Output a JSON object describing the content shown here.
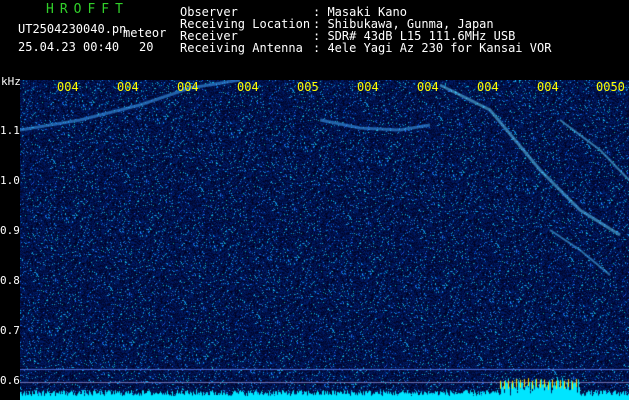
{
  "app": {
    "name": "HROFFT",
    "filename": "UT2504230040.pn",
    "mode": "meteor",
    "date_time": "25.04.23 00:40",
    "interval": "20"
  },
  "info": {
    "labels": [
      "Observer",
      "Receiving Location",
      "Receiver",
      "Receiving Antenna"
    ],
    "values": [
      ": Masaki Kano",
      ": Shibukawa, Gunma, Japan",
      ": SDR# 43dB L15 111.6MHz USB",
      ": 4ele Yagi Az 230 for Kansai VOR"
    ]
  },
  "axis": {
    "unit": "kHz",
    "freq_ticks": [
      "1.1",
      "1.0",
      "0.9",
      "0.8",
      "0.7",
      "0.6"
    ],
    "time_ticks": [
      "004",
      "004",
      "004",
      "004",
      "005",
      "004",
      "004",
      "004",
      "004",
      "0050"
    ]
  },
  "colors": {
    "background": "#000000",
    "spectrogram_low": "#00003a",
    "spectrogram_high": "#f4ff7a",
    "time_labels": "#ffff00",
    "app_name": "#31d02a",
    "baseline": "#00e5ff"
  }
}
